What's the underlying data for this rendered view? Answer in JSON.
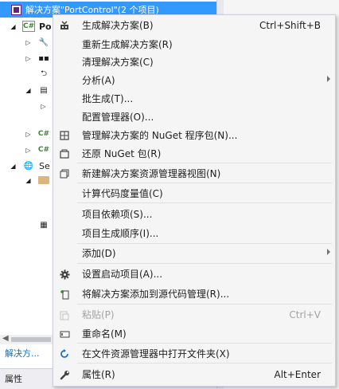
{
  "explorer": {
    "solution_label": "解决方案\"PortControl\"(2 个项目)",
    "project_label": "Po",
    "services_label": "Se",
    "bottom_tab_label": "解决方...",
    "properties_label": "属性"
  },
  "context_menu": {
    "items": [
      {
        "label": "生成解决方案(B)",
        "shortcut": "Ctrl+Shift+B",
        "icon": "build-icon"
      },
      {
        "label": "重新生成解决方案(R)"
      },
      {
        "label": "清理解决方案(C)"
      },
      {
        "label": "分析(A)",
        "submenu": true
      },
      {
        "label": "批生成(T)..."
      },
      {
        "label": "配置管理器(O)..."
      },
      {
        "label": "管理解决方案的 NuGet 程序包(N)...",
        "icon": "nuget-package-icon"
      },
      {
        "label": "还原 NuGet 包(R)",
        "icon": "nuget-restore-icon"
      },
      {
        "label": "新建解决方案资源管理器视图(N)",
        "icon": "new-view-icon"
      },
      {
        "label": "计算代码度量值(C)"
      },
      {
        "label": "项目依赖项(S)..."
      },
      {
        "label": "项目生成顺序(I)..."
      },
      {
        "label": "添加(D)",
        "submenu": true
      },
      {
        "label": "设置启动项目(A)...",
        "icon": "gear-icon"
      },
      {
        "label": "将解决方案添加到源代码管理(R)...",
        "icon": "source-control-add-icon"
      },
      {
        "label": "粘贴(P)",
        "shortcut": "Ctrl+V",
        "disabled": true,
        "icon": "paste-icon"
      },
      {
        "label": "重命名(M)",
        "icon": "rename-icon"
      },
      {
        "label": "在文件资源管理器中打开文件夹(X)",
        "icon": "refresh-arrow-icon"
      },
      {
        "label": "属性(R)",
        "shortcut": "Alt+Enter",
        "icon": "wrench-icon"
      }
    ]
  },
  "colors": {
    "selection": "#3399ff",
    "menu_background": "#f5f5f5",
    "disabled_text": "#a2a4a5",
    "accent_link": "#0e70c0"
  }
}
